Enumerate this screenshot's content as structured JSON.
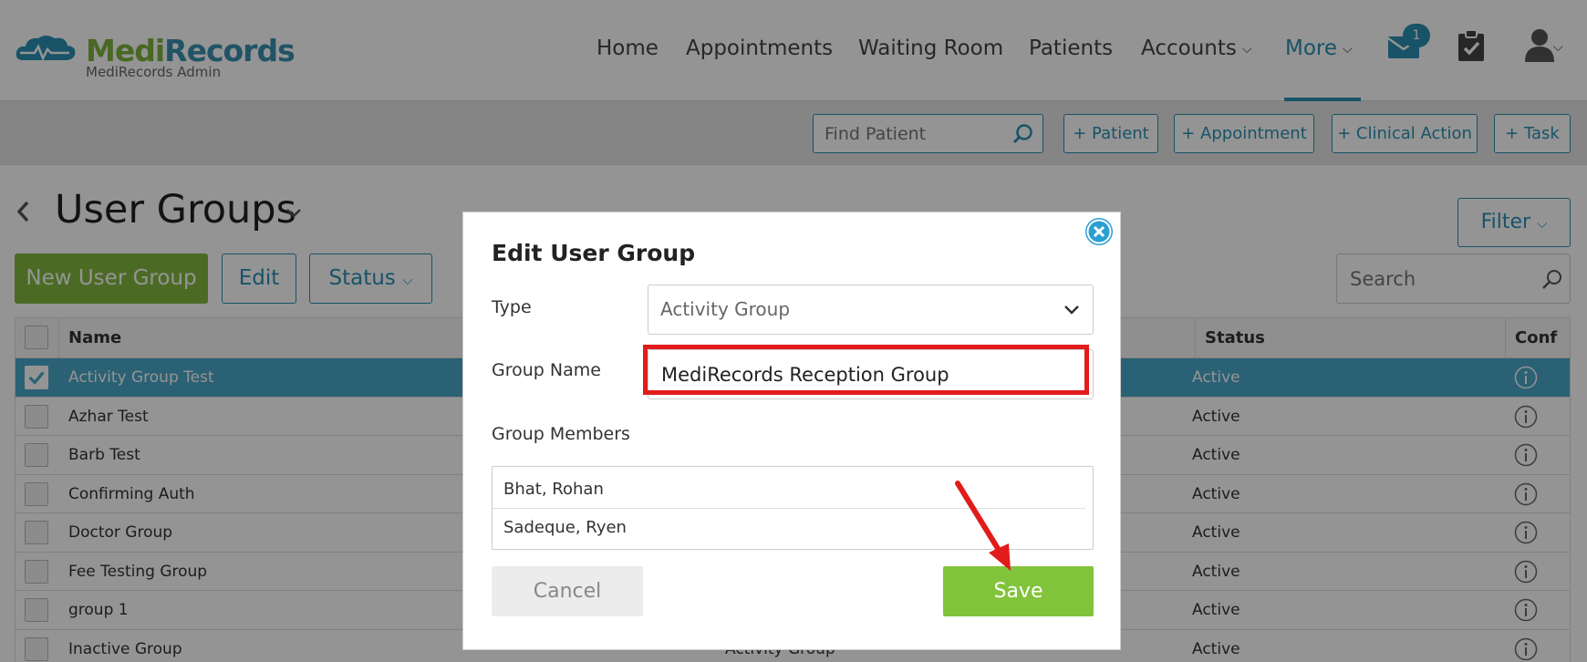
{
  "brand": {
    "name_part1": "Medi",
    "name_part2": "Records",
    "subtitle": "MediRecords Admin"
  },
  "nav": {
    "items": [
      "Home",
      "Appointments",
      "Waiting Room",
      "Patients",
      "Accounts",
      "More"
    ],
    "active": "More",
    "mail_badge": "1"
  },
  "toolbar": {
    "find_patient_placeholder": "Find Patient",
    "buttons": [
      "+ Patient",
      "+ Appointment",
      "+ Clinical Action",
      "+ Task"
    ]
  },
  "page": {
    "title": "User Groups",
    "filter_label": "Filter",
    "new_button": "New User Group",
    "edit_button": "Edit",
    "status_button": "Status",
    "search_placeholder": "Search"
  },
  "table": {
    "columns": {
      "name": "Name",
      "status": "Status",
      "conf": "Conf"
    },
    "rows": [
      {
        "name": "Activity Group Test",
        "type": "",
        "status": "Active",
        "selected": true
      },
      {
        "name": "Azhar Test",
        "type": "",
        "status": "Active",
        "selected": false
      },
      {
        "name": "Barb Test",
        "type": "",
        "status": "Active",
        "selected": false
      },
      {
        "name": "Confirming Auth",
        "type": "",
        "status": "Active",
        "selected": false
      },
      {
        "name": "Doctor Group",
        "type": "",
        "status": "Active",
        "selected": false
      },
      {
        "name": "Fee Testing Group",
        "type": "",
        "status": "Active",
        "selected": false
      },
      {
        "name": "group 1",
        "type": "",
        "status": "Active",
        "selected": false
      },
      {
        "name": "Inactive Group",
        "type": "Activity Group",
        "status": "Active",
        "selected": false
      }
    ]
  },
  "modal": {
    "title": "Edit User Group",
    "type_label": "Type",
    "type_value": "Activity Group",
    "group_name_label": "Group Name",
    "group_name_value": "MediRecords Reception Group",
    "members_label": "Group Members",
    "members": [
      "Bhat, Rohan",
      "Sadeque, Ryen"
    ],
    "cancel_label": "Cancel",
    "save_label": "Save"
  },
  "colors": {
    "brand_blue": "#2a8fb3",
    "brand_green": "#82b83f",
    "save_green": "#82c33c",
    "highlight_red": "#e21b1b",
    "selected_row": "#4ba8c9"
  }
}
